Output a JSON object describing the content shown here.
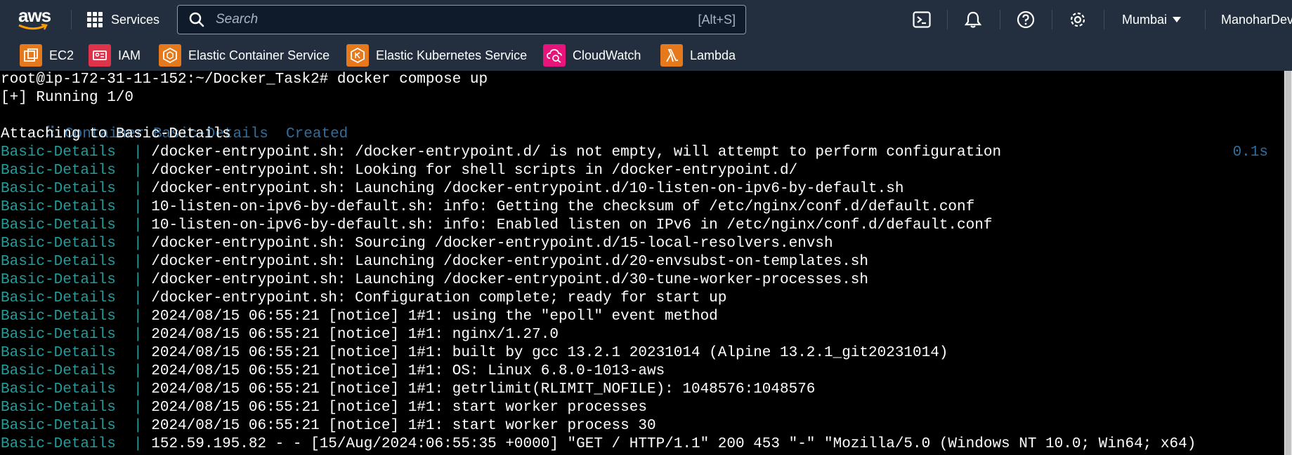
{
  "topbar": {
    "logo_text": "aws",
    "services_label": "Services",
    "search_placeholder": "Search",
    "search_shortcut": "[Alt+S]",
    "region": "Mumbai",
    "user": "ManoharDev",
    "icons": [
      "cloudshell-icon",
      "bell-icon",
      "help-icon",
      "gear-icon"
    ]
  },
  "favorites": [
    {
      "label": "EC2",
      "color": "#e7791d",
      "icon": "ec2-icon"
    },
    {
      "label": "IAM",
      "color": "#dd344c",
      "icon": "iam-icon"
    },
    {
      "label": "Elastic Container Service",
      "color": "#e7791d",
      "icon": "ecs-icon"
    },
    {
      "label": "Elastic Kubernetes Service",
      "color": "#e7791d",
      "icon": "eks-icon"
    },
    {
      "label": "CloudWatch",
      "color": "#e7157b",
      "icon": "cloudwatch-icon"
    },
    {
      "label": "Lambda",
      "color": "#e7791d",
      "icon": "lambda-icon"
    }
  ],
  "terminal": {
    "prompt": "root@ip-172-31-11-152:~/Docker_Task2# docker compose up",
    "running": "[+] Running 1/0",
    "container_status": " ⠿ Container Basic-Details  Created",
    "container_time": "0.1s",
    "attaching": "Attaching to Basic-Details",
    "prefix": "Basic-Details  | ",
    "lines": [
      "/docker-entrypoint.sh: /docker-entrypoint.d/ is not empty, will attempt to perform configuration",
      "/docker-entrypoint.sh: Looking for shell scripts in /docker-entrypoint.d/",
      "/docker-entrypoint.sh: Launching /docker-entrypoint.d/10-listen-on-ipv6-by-default.sh",
      "10-listen-on-ipv6-by-default.sh: info: Getting the checksum of /etc/nginx/conf.d/default.conf",
      "10-listen-on-ipv6-by-default.sh: info: Enabled listen on IPv6 in /etc/nginx/conf.d/default.conf",
      "/docker-entrypoint.sh: Sourcing /docker-entrypoint.d/15-local-resolvers.envsh",
      "/docker-entrypoint.sh: Launching /docker-entrypoint.d/20-envsubst-on-templates.sh",
      "/docker-entrypoint.sh: Launching /docker-entrypoint.d/30-tune-worker-processes.sh",
      "/docker-entrypoint.sh: Configuration complete; ready for start up",
      "2024/08/15 06:55:21 [notice] 1#1: using the \"epoll\" event method",
      "2024/08/15 06:55:21 [notice] 1#1: nginx/1.27.0",
      "2024/08/15 06:55:21 [notice] 1#1: built by gcc 13.2.1 20231014 (Alpine 13.2.1_git20231014)",
      "2024/08/15 06:55:21 [notice] 1#1: OS: Linux 6.8.0-1013-aws",
      "2024/08/15 06:55:21 [notice] 1#1: getrlimit(RLIMIT_NOFILE): 1048576:1048576",
      "2024/08/15 06:55:21 [notice] 1#1: start worker processes",
      "2024/08/15 06:55:21 [notice] 1#1: start worker process 30",
      "152.59.195.82 - - [15/Aug/2024:06:55:35 +0000] \"GET / HTTP/1.1\" 200 453 \"-\" \"Mozilla/5.0 (Windows NT 10.0; Win64; x64)"
    ]
  }
}
